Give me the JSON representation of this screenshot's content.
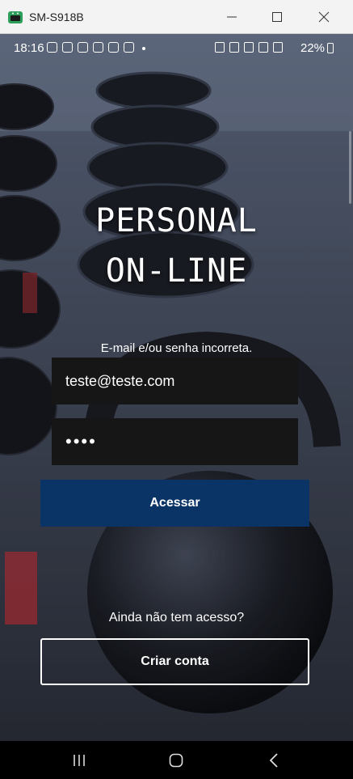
{
  "window": {
    "title": "SM-S918B",
    "accent": "#2e9e5b"
  },
  "statusbar": {
    "time": "18:16",
    "battery": "22%"
  },
  "brand": {
    "line1": "PERSONAL",
    "line2": "ON-LINE"
  },
  "login": {
    "error_message": "E-mail e/ou senha incorreta.",
    "email_value": "teste@teste.com",
    "password_value": "••••",
    "submit_label": "Acessar",
    "submit_color": "#0b3466"
  },
  "signup": {
    "prompt": "Ainda não tem acesso?",
    "button_label": "Criar conta"
  },
  "navbar": {
    "recents_icon": "recents-icon",
    "home_icon": "home-icon",
    "back_icon": "back-icon"
  }
}
